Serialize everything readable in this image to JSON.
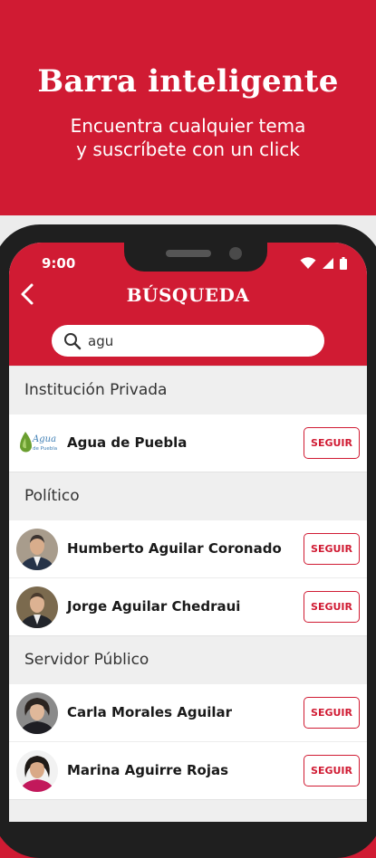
{
  "promo": {
    "title": "Barra inteligente",
    "subtitle_line1": "Encuentra cualquier tema",
    "subtitle_line2": "y suscríbete con un click"
  },
  "status_bar": {
    "time": "9:00",
    "icons": [
      "wifi-icon",
      "signal-icon",
      "battery-icon"
    ]
  },
  "app_bar": {
    "title": "BÚSQUEDA",
    "back_icon": "back-arrow-icon"
  },
  "search": {
    "value": "agu",
    "placeholder": "",
    "icon": "search-icon"
  },
  "results": {
    "groups": [
      {
        "category": "Institución Privada",
        "items": [
          {
            "name": "Agua de Puebla",
            "logo_text": "Agua",
            "logo_subtext": "de Puebla",
            "follow_label": "SEGUIR"
          }
        ]
      },
      {
        "category": "Político",
        "items": [
          {
            "name": "Humberto Aguilar Coronado",
            "follow_label": "SEGUIR"
          },
          {
            "name": "Jorge Aguilar Chedraui",
            "follow_label": "SEGUIR"
          }
        ]
      },
      {
        "category": "Servidor Público",
        "items": [
          {
            "name": "Carla Morales Aguilar",
            "follow_label": "SEGUIR"
          },
          {
            "name": "Marina Aguirre Rojas",
            "follow_label": "SEGUIR"
          }
        ]
      }
    ]
  },
  "colors": {
    "brand_red": "#d01b33",
    "category_bg": "#efefef",
    "phone_frame": "#1f1f1f"
  }
}
